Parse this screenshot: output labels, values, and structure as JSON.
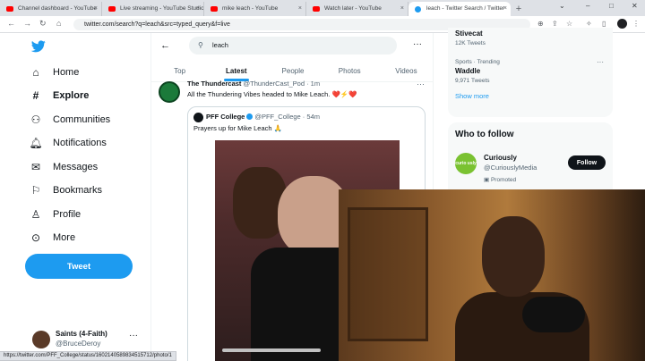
{
  "browser": {
    "tabs": [
      {
        "title": "Channel dashboard - YouTube",
        "icon": "youtube-icon"
      },
      {
        "title": "Live streaming - YouTube Studio",
        "icon": "youtube-icon"
      },
      {
        "title": "mike leach - YouTube",
        "icon": "youtube-icon"
      },
      {
        "title": "Watch later - YouTube",
        "icon": "youtube-icon"
      },
      {
        "title": "leach - Twitter Search / Twitter",
        "icon": "twitter-icon",
        "active": true
      }
    ],
    "url": "twitter.com/search?q=leach&src=typed_query&f=live",
    "status_url": "https://twitter.com/PFF_College/status/1602140589834515712/photo/1"
  },
  "sidebar": {
    "items": [
      {
        "label": "Home",
        "icon": "home-icon"
      },
      {
        "label": "Explore",
        "icon": "hashtag-icon",
        "active": true
      },
      {
        "label": "Communities",
        "icon": "communities-icon"
      },
      {
        "label": "Notifications",
        "icon": "bell-icon"
      },
      {
        "label": "Messages",
        "icon": "envelope-icon"
      },
      {
        "label": "Bookmarks",
        "icon": "bookmark-icon"
      },
      {
        "label": "Profile",
        "icon": "person-icon"
      },
      {
        "label": "More",
        "icon": "more-circle-icon"
      }
    ],
    "tweet_label": "Tweet",
    "account": {
      "name": "Saints (4-Faith)",
      "handle": "@BruceDeroy"
    }
  },
  "search": {
    "query": "leach",
    "tabs": [
      "Top",
      "Latest",
      "People",
      "Photos",
      "Videos"
    ],
    "active_tab": "Latest"
  },
  "tweet": {
    "author": "The Thundercast",
    "meta": "@ThunderCast_Pod · 1m",
    "text": "All the Thundering Vibes headed to Mike Leach. ❤️⚡❤️",
    "quote": {
      "author": "PFF College",
      "meta": "@PFF_College · 54m",
      "text": "Prayers up for Mike Leach 🙏"
    }
  },
  "trends": [
    {
      "name": "Stivecat",
      "meta": "12K Tweets"
    },
    {
      "category": "Sports · Trending",
      "name": "Waddle",
      "meta": "9,971 Tweets"
    }
  ],
  "show_more": "Show more",
  "who_to_follow": {
    "title": "Who to follow",
    "name": "Curiously",
    "handle": "@CuriouslyMedia",
    "avatar_text": "curio usly",
    "promoted": "Promoted",
    "follow_label": "Follow"
  }
}
